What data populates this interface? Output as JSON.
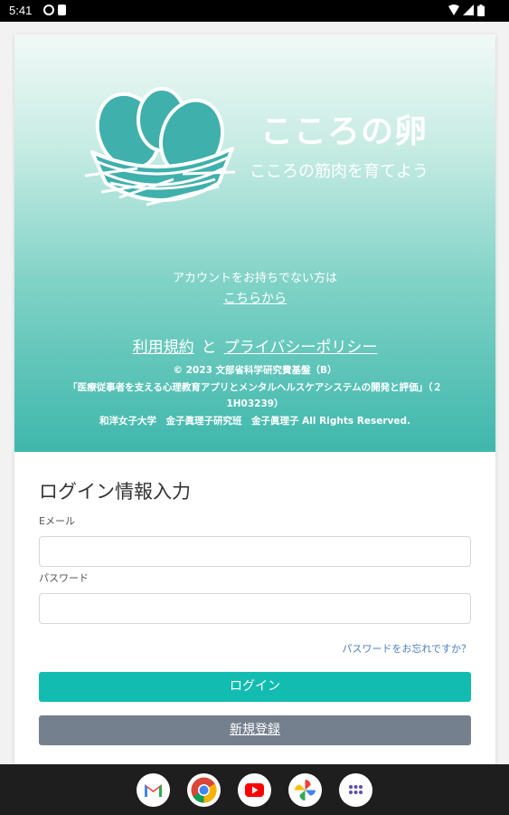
{
  "status_bar": {
    "time": "5:41"
  },
  "header": {
    "app_title": "こころの卵",
    "tagline": "こころの筋肉を育てよう"
  },
  "account": {
    "prompt": "アカウントをお持ちでない方は",
    "register_link": "こちらから"
  },
  "legal": {
    "terms_link": "利用規約",
    "and_text": "と",
    "privacy_link": "プライバシーポリシー",
    "copyright_lines": [
      "© 2023 文部省科学研究費基盤（B）",
      "「医療従事者を支える心理教育アプリとメンタルヘルスケアシステムの開発と評価」（２",
      "1H03239）",
      "和洋女子大学　金子眞理子研究班　金子眞理子 All Rights Reserved."
    ]
  },
  "login_form": {
    "title": "ログイン情報入力",
    "email_label": "Eメール",
    "email_value": "",
    "password_label": "パスワード",
    "password_value": "",
    "forgot_link": "パスワードをお忘れですか？",
    "login_button": "ログイン",
    "register_button": "新規登録"
  },
  "dock": {
    "apps": [
      "gmail-icon",
      "chrome-icon",
      "youtube-icon",
      "photos-icon",
      "app-drawer-icon"
    ]
  },
  "colors": {
    "accent": "#12bcb0",
    "secondary_button": "#75808f",
    "link": "#4a7fc4"
  }
}
